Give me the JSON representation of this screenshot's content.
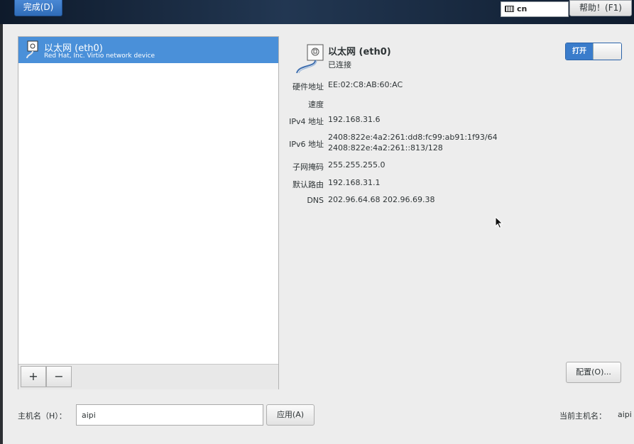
{
  "topbar": {
    "done_label": "完成(D)",
    "keyboard_layout": "cn",
    "help_label": "帮助！(F1)"
  },
  "connections": {
    "items": [
      {
        "title": "以太网 (eth0)",
        "subtitle": "Red Hat, Inc. Virtio network device",
        "selected": true
      }
    ],
    "add_label": "+",
    "remove_label": "−"
  },
  "details": {
    "name": "以太网 (eth0)",
    "status": "已连接",
    "toggle_label": "打开",
    "toggle_on": true,
    "properties": [
      {
        "label": "硬件地址",
        "values": [
          "EE:02:C8:AB:60:AC"
        ]
      },
      {
        "label": "速度",
        "values": [
          ""
        ]
      },
      {
        "label": "IPv4 地址",
        "values": [
          "192.168.31.6"
        ]
      },
      {
        "label": "IPv6 地址",
        "values": [
          "2408:822e:4a2:261:dd8:fc99:ab91:1f93/64",
          "2408:822e:4a2:261::813/128"
        ]
      },
      {
        "label": "子网掩码",
        "values": [
          "255.255.255.0"
        ]
      },
      {
        "label": "默认路由",
        "values": [
          "192.168.31.1"
        ]
      },
      {
        "label": "DNS",
        "values": [
          "202.96.64.68 202.96.69.38"
        ]
      }
    ],
    "config_label": "配置(O)..."
  },
  "hostname": {
    "label": "主机名（H）：",
    "value": "aipi",
    "apply_label": "应用(A)",
    "current_label": "当前主机名：",
    "current_value": "aipi"
  },
  "colors": {
    "accent": "#4a90d9",
    "panel_bg": "#ededed"
  }
}
